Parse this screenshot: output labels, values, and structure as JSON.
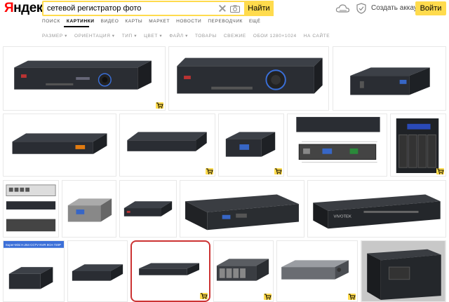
{
  "logo": {
    "first": "Я",
    "rest": "ндекс"
  },
  "search": {
    "query": "сетевой регистратор фото",
    "button": "Найти"
  },
  "header": {
    "create_account": "Создать аккаунт",
    "login": "Войти"
  },
  "services": [
    "поиск",
    "картинки",
    "видео",
    "карты",
    "маркет",
    "новости",
    "переводчик",
    "ещё"
  ],
  "filters": [
    "размер ▾",
    "ориентация ▾",
    "тип ▾",
    "цвет ▾",
    "файл ▾",
    "товары",
    "свежие",
    "обои 1280×1024",
    "на сайте"
  ],
  "tiles": [
    {
      "name": "dvr-dahua-front",
      "cart": true
    },
    {
      "name": "dvr-dahua-large",
      "cart": false
    },
    {
      "name": "mini-nvr-black",
      "cart": false
    },
    {
      "name": "nvr-flat-orange-label",
      "cart": false
    },
    {
      "name": "nvr-slim-black",
      "cart": true
    },
    {
      "name": "mini-nvr-vga",
      "cart": true
    },
    {
      "name": "nvr-rear-diagram",
      "cart": false
    },
    {
      "name": "nas-4bay",
      "cart": true
    },
    {
      "name": "nvr-poe-ports",
      "cart": false
    },
    {
      "name": "mini-nvr-silver",
      "cart": false
    },
    {
      "name": "nvr-compact",
      "cart": false
    },
    {
      "name": "ubiquiti-nvr",
      "cart": false
    },
    {
      "name": "vivotek-nvr",
      "cart": false
    },
    {
      "name": "super-mini-nvr",
      "cart": false
    },
    {
      "name": "nvr-slim-2",
      "cart": false
    },
    {
      "name": "nvr-selected",
      "cart": true
    },
    {
      "name": "rack-nvr-4bay",
      "cart": true
    },
    {
      "name": "nvr-silver-front",
      "cart": true
    },
    {
      "name": "mini-itx-case",
      "cart": false
    }
  ],
  "tile_texts": {
    "super_mini_banner": "Super-Mini H.264 CCTV NVR 8CH 720P",
    "vivotek": "VIVOTEK"
  }
}
